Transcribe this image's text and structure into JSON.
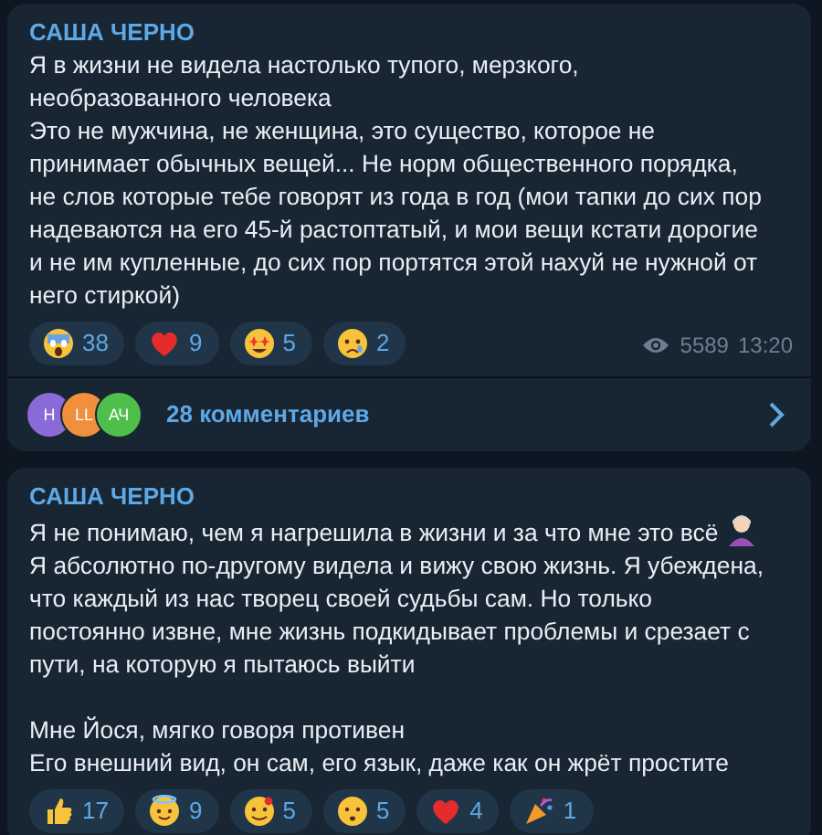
{
  "messages": [
    {
      "author": "САША ЧЕРНО",
      "paragraphs": [
        {
          "kind": "plain",
          "text": "Я в жизни не видела настолько тупого, мерзкого, необразованного человека"
        },
        {
          "kind": "plain",
          "text": "Это не мужчина, не женщина, это существо, которое не принимает обычных вещей... Не норм общественного порядка, не слов которые тебе говорят из года в год (мои тапки до сих пор надеваются на его 45-й растоптатый, и мои вещи кстати дорогие и не им купленные, до сих пор портятся этой нахуй не нужной от него стиркой)"
        }
      ],
      "reactions": [
        {
          "kind": "scream",
          "count": "38"
        },
        {
          "kind": "heart",
          "count": "9"
        },
        {
          "kind": "starstruck",
          "count": "5"
        },
        {
          "kind": "cry",
          "count": "2"
        }
      ],
      "views": "5589",
      "time": "13:20",
      "comments": {
        "avatars": [
          {
            "initials": "Н",
            "color": "#8a6ad6"
          },
          {
            "initials": "LL",
            "color": "#f0903c"
          },
          {
            "initials": "АЧ",
            "color": "#4fbf4c"
          }
        ],
        "label": "28 комментариев"
      }
    },
    {
      "author": "САША ЧЕРНО",
      "paragraphs": [
        {
          "kind": "with_emoji",
          "text": "Я не понимаю, чем я нагрешила в жизни и за что мне это всё"
        },
        {
          "kind": "plain",
          "text": "Я абсолютно по-другому видела и вижу свою жизнь. Я убеждена, что каждый из нас творец своей судьбы сам. Но только постоянно извне, мне жизнь подкидывает проблемы и срезает с пути, на которую я пытаюсь выйти\n\nМне Йося, мягко говоря противен\nЕго внешний вид, он сам, его язык, даже как он жрёт простите"
        }
      ],
      "reactions": [
        {
          "kind": "thumbs",
          "count": "17"
        },
        {
          "kind": "halo",
          "count": "9"
        },
        {
          "kind": "hearts",
          "count": "5"
        },
        {
          "kind": "hush",
          "count": "5"
        },
        {
          "kind": "heart",
          "count": "4"
        },
        {
          "kind": "party",
          "count": "1"
        }
      ]
    }
  ]
}
